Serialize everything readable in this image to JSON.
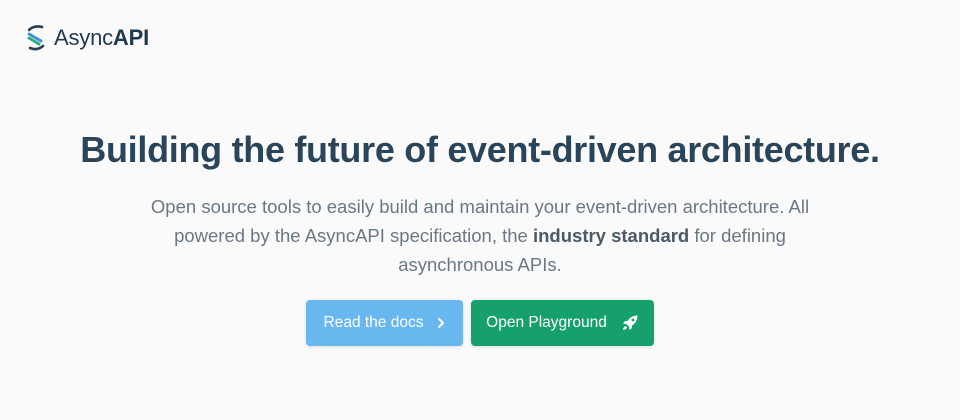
{
  "header": {
    "brand_prefix": "Async",
    "brand_suffix": "API",
    "logo_icon": "asyncapi-logo-icon"
  },
  "hero": {
    "headline": "Building the future of event-driven architecture.",
    "subtitle_part1": "Open source tools to easily build and maintain your event-driven architecture. All powered by the AsyncAPI specification, the ",
    "subtitle_bold": "industry standard",
    "subtitle_part2": " for defining asynchronous APIs."
  },
  "actions": {
    "docs_label": "Read the docs",
    "docs_icon": "chevron-right-icon",
    "docs_color": "#68b7ee",
    "playground_label": "Open Playground",
    "playground_icon": "rocket-icon",
    "playground_color": "#16a16c"
  }
}
